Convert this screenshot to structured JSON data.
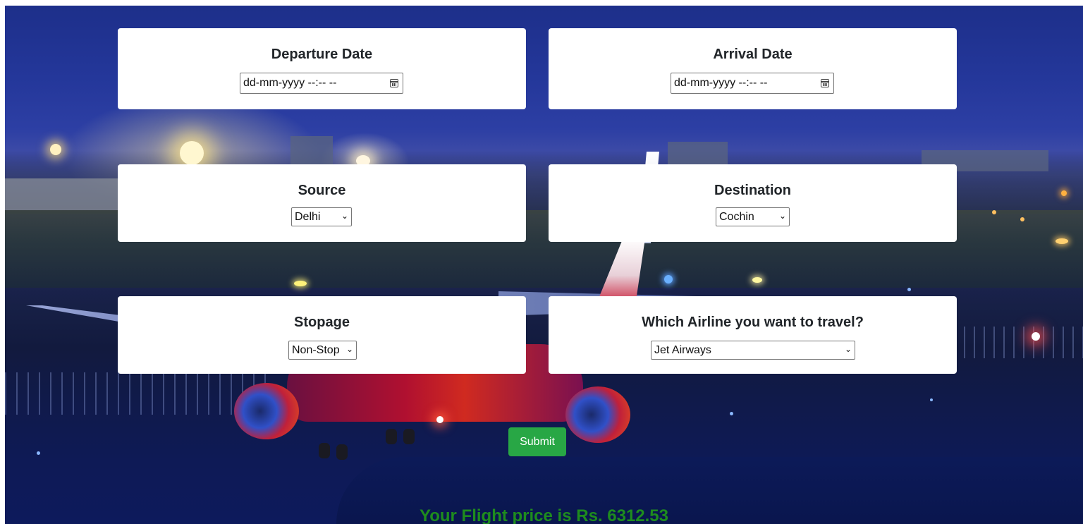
{
  "form": {
    "departure": {
      "label": "Departure Date",
      "placeholder": "dd-mm-yyyy --:-- --"
    },
    "arrival": {
      "label": "Arrival Date",
      "placeholder": "dd-mm-yyyy --:-- --"
    },
    "source": {
      "label": "Source",
      "value": "Delhi"
    },
    "destination": {
      "label": "Destination",
      "value": "Cochin"
    },
    "stoppage": {
      "label": "Stopage",
      "value": "Non-Stop"
    },
    "airline": {
      "label": "Which Airline you want to travel?",
      "value": "Jet Airways"
    },
    "submit_label": "Submit"
  },
  "result": {
    "text": "Your Flight price is Rs. 6312.53"
  },
  "icons": {
    "calendar": "calendar-icon",
    "dropdown": "chevron-down-icon"
  },
  "colors": {
    "submit_bg": "#28a745",
    "result_text": "#1e8c1e",
    "card_bg": "#ffffff"
  }
}
